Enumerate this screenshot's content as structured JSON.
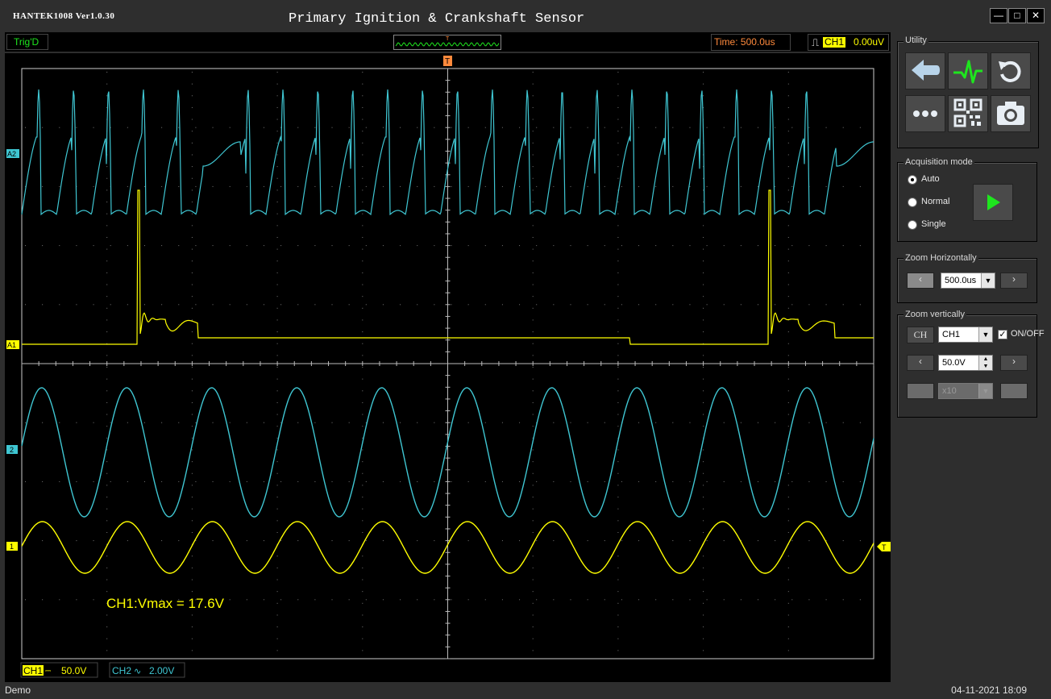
{
  "app": {
    "version": "HANTEK1008 Ver1.0.30",
    "title": "Primary Ignition & Crankshaft Sensor"
  },
  "status": {
    "trig": "Trig'D",
    "time": "Time: 500.0us",
    "trigger_channel": "CH1",
    "trigger_level": "0.00uV"
  },
  "scope": {
    "markers": {
      "a2": "A2",
      "a1": "A1",
      "ch2": "2",
      "ch1": "1",
      "trigger_top": "T",
      "trigger_right": "T"
    },
    "measurement": "CH1:Vmax = 17.6V",
    "ch1_scale": {
      "label": "CH1",
      "value": "50.0V"
    },
    "ch2_scale": {
      "label": "CH2",
      "value": "2.00V"
    }
  },
  "utility": {
    "legend": "Utility",
    "icons": [
      "back-arrow-icon",
      "waveform-icon",
      "reset-icon",
      "more-icon",
      "qr-code-icon",
      "camera-icon"
    ]
  },
  "acquisition": {
    "legend": "Acquisition mode",
    "modes": [
      "Auto",
      "Normal",
      "Single"
    ],
    "selected": "Auto"
  },
  "zoom_h": {
    "legend": "Zoom Horizontally",
    "value": "500.0us"
  },
  "zoom_v": {
    "legend": "Zoom vertically",
    "ch_button": "CH",
    "channel": "CH1",
    "onoff_label": "ON/OFF",
    "onoff_checked": true,
    "volts": "50.0V",
    "probe": "x10"
  },
  "bottom": {
    "status": "Demo",
    "datetime": "04-11-2021  18:09"
  },
  "colors": {
    "ch1": "#ffff00",
    "ch2": "#3fc6d2",
    "trig": "#ff8a3c",
    "green": "#1ee61e"
  }
}
